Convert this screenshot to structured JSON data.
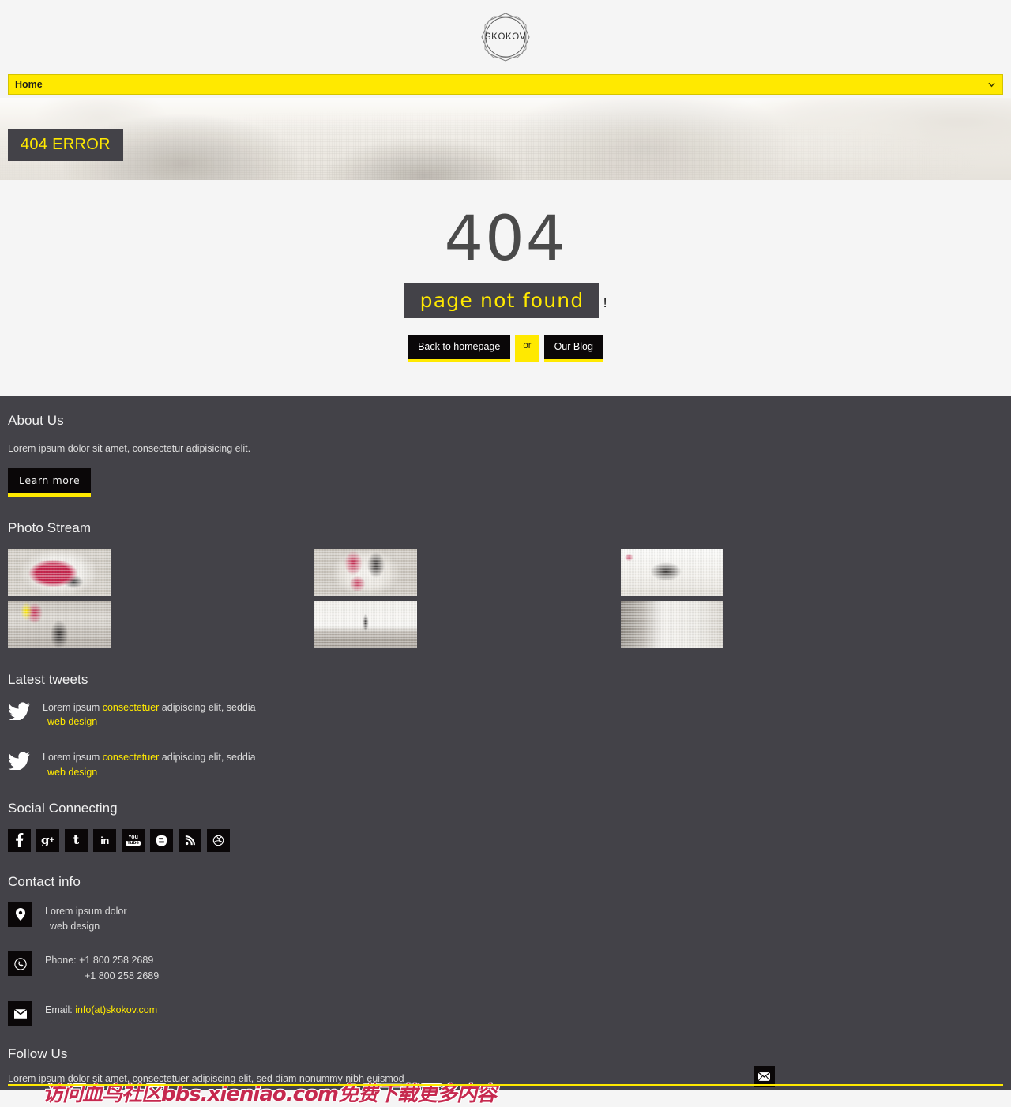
{
  "header": {
    "logo_text": "SKOKOV",
    "logo_icon": "star-octagon-logo"
  },
  "nav": {
    "selected": "Home",
    "chevron_icon": "chevron-down-icon",
    "options": [
      "Home"
    ]
  },
  "hero": {
    "error_tag": "404 ERROR"
  },
  "main": {
    "code": "404",
    "message": "page not found",
    "exclamation": "!",
    "buttons": {
      "homepage": "Back to homepage",
      "or": "or",
      "blog": "Our Blog"
    }
  },
  "footer": {
    "about": {
      "title": "About Us",
      "text": "Lorem ipsum dolor sit amet, consectetur adipisicing elit.",
      "button": "Learn more"
    },
    "photo_stream": {
      "title": "Photo Stream",
      "columns": [
        [
          {
            "name": "photo-red-abstract"
          },
          {
            "name": "photo-woman-yellow"
          }
        ],
        [
          {
            "name": "photo-portrait-red"
          },
          {
            "name": "photo-skater"
          }
        ],
        [
          {
            "name": "photo-horse-abstract"
          },
          {
            "name": "photo-sofa"
          }
        ]
      ]
    },
    "tweets": {
      "title": "Latest tweets",
      "icon": "twitter-bird-icon",
      "items": [
        {
          "pre": "Lorem ipsum ",
          "link": "consectetuer",
          "post": " adipiscing elit, seddia",
          "tag": "web design"
        },
        {
          "pre": "Lorem ipsum ",
          "link": "consectetuer",
          "post": " adipiscing elit, seddia",
          "tag": "web design"
        }
      ]
    },
    "social": {
      "title": "Social Connecting",
      "items": [
        {
          "name": "facebook-icon",
          "glyph": "f"
        },
        {
          "name": "google-plus-icon",
          "glyph": "g+"
        },
        {
          "name": "twitter-icon",
          "glyph": "t"
        },
        {
          "name": "linkedin-icon",
          "glyph": "in"
        },
        {
          "name": "youtube-icon",
          "glyph": "You Tube"
        },
        {
          "name": "blogger-icon",
          "glyph": "B"
        },
        {
          "name": "rss-icon",
          "glyph": "rss"
        },
        {
          "name": "dribbble-icon",
          "glyph": "dribbble"
        }
      ]
    },
    "contact": {
      "title": "Contact info",
      "address": {
        "icon": "location-pin-icon",
        "line1": "Lorem ipsum dolor",
        "line2": "web design"
      },
      "phone": {
        "icon": "phone-icon",
        "label": "Phone: ",
        "number1": "+1 800 258 2689",
        "number2": "+1 800 258 2689"
      },
      "email": {
        "icon": "envelope-icon",
        "label": "Email: ",
        "value": "info(at)skokov.com"
      }
    },
    "follow": {
      "title": "Follow Us",
      "text": "Lorem ipsum dolor sit amet, consectetuer adipiscing elit, sed diam nonummy nibh euismod",
      "submit_icon": "envelope-icon"
    },
    "watermark": "访问血鸟社区bbs.xieniao.com免费下载更多内容"
  },
  "colors": {
    "accent_yellow": "#ffe900",
    "dark_panel": "#434248",
    "black_button": "#0a0708",
    "page_bg": "#f5f5f5",
    "red": "#c6294f"
  }
}
